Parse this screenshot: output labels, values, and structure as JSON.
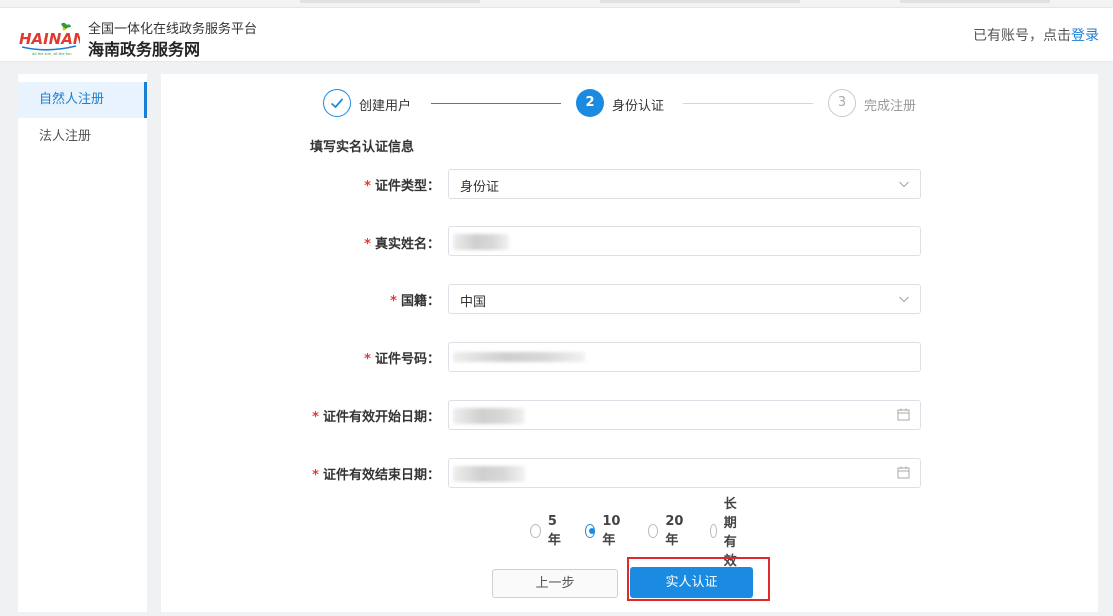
{
  "header": {
    "logo_text": "HAINAN",
    "logo_slogan": "All the sun, all the fun",
    "subtitle": "全国一体化在线政务服务平台",
    "title": "海南政务服务网",
    "login_prompt": "已有账号，点击",
    "login_link": "登录"
  },
  "sidebar": {
    "items": [
      {
        "label": "自然人注册",
        "active": true
      },
      {
        "label": "法人注册",
        "active": false
      }
    ]
  },
  "steps": [
    {
      "index": "✓",
      "label": "创建用户",
      "state": "done"
    },
    {
      "index": "2",
      "label": "身份认证",
      "state": "current"
    },
    {
      "index": "3",
      "label": "完成注册",
      "state": "todo"
    }
  ],
  "form": {
    "section_title": "填写实名认证信息",
    "required_mark": "*",
    "fields": {
      "id_type": {
        "label": "证件类型：",
        "value": "身份证"
      },
      "real_name": {
        "label": "真实姓名：",
        "value": ""
      },
      "nationality": {
        "label": "国籍：",
        "value": "中国"
      },
      "id_number": {
        "label": "证件号码：",
        "value": ""
      },
      "valid_start": {
        "label": "证件有效开始日期：",
        "value": ""
      },
      "valid_end": {
        "label": "证件有效结束日期：",
        "value": ""
      }
    },
    "validity_options": [
      {
        "label": "5年",
        "selected": false
      },
      {
        "label": "10年",
        "selected": true
      },
      {
        "label": "20年",
        "selected": false
      },
      {
        "label": "长期有效",
        "selected": false
      }
    ],
    "prev_button": "上一步",
    "submit_button": "实人认证"
  },
  "colors": {
    "accent": "#1a8be0",
    "link": "#1a7fd4",
    "required": "#e4393c",
    "highlight": "#e02a2a"
  }
}
